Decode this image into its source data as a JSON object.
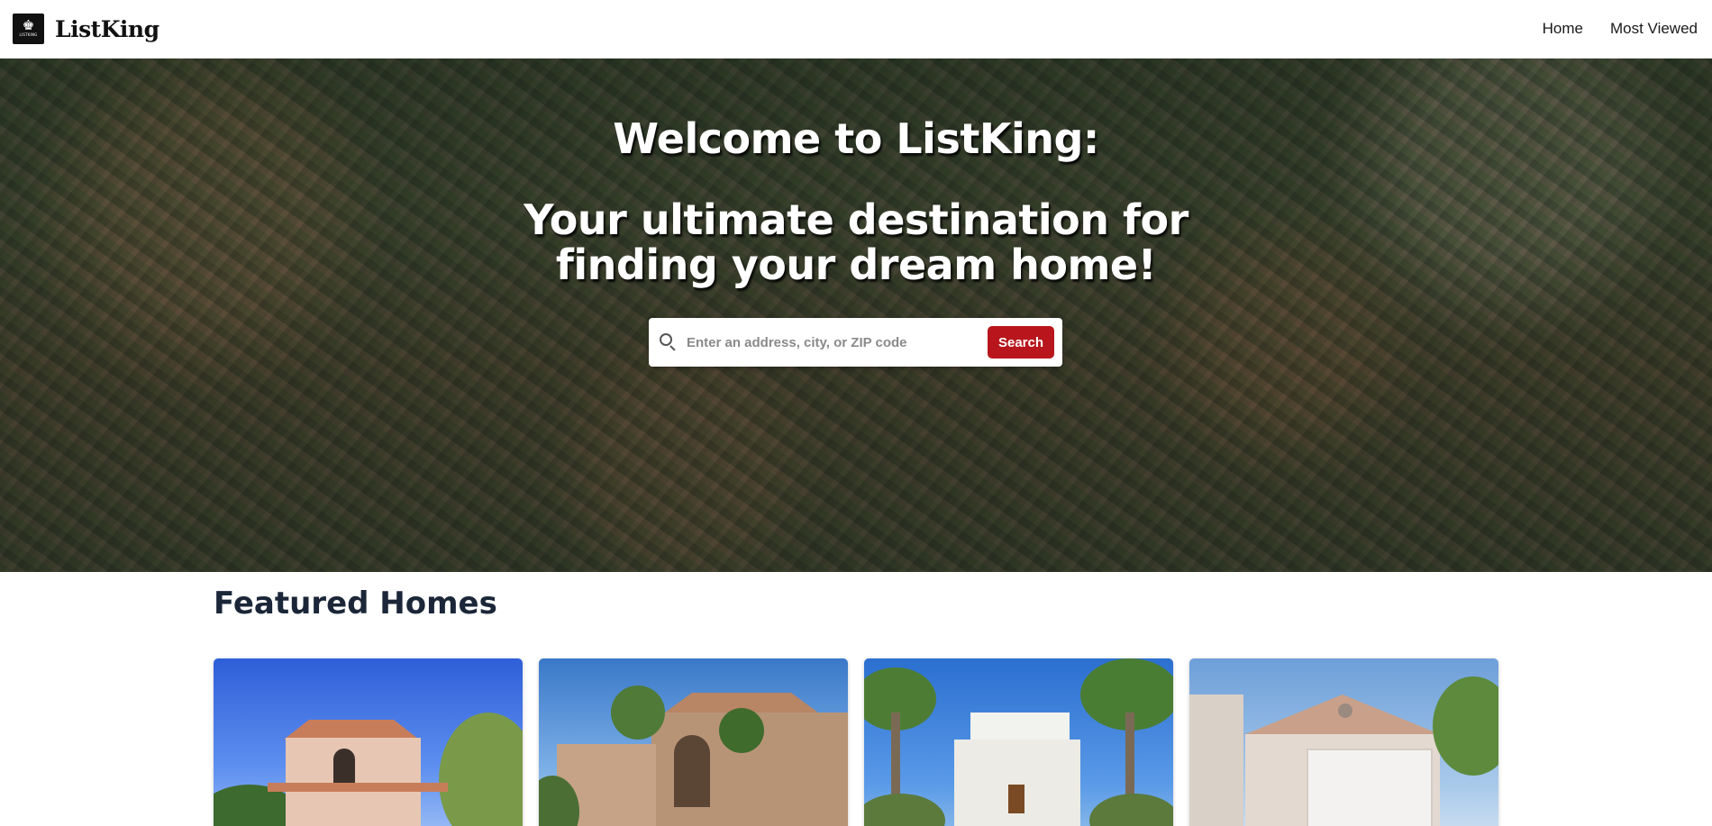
{
  "header": {
    "brand_name": "ListKing",
    "logo_text": "LISTKING",
    "nav": [
      {
        "label": "Home"
      },
      {
        "label": "Most Viewed"
      }
    ]
  },
  "hero": {
    "title": "Welcome to ListKing:",
    "subtitle": "Your ultimate destination for finding your dream home!",
    "search": {
      "placeholder": "Enter an address, city, or ZIP code",
      "value": "",
      "button_label": "Search"
    }
  },
  "featured": {
    "heading": "Featured Homes",
    "cards": [
      {
        "image": "two-story stucco house with arched window"
      },
      {
        "image": "tan stucco house with palm trees"
      },
      {
        "image": "white modern house with palm trees"
      },
      {
        "image": "beige single-story house with garage"
      }
    ]
  },
  "colors": {
    "accent": "#b8161c",
    "heading": "#1b2638"
  }
}
